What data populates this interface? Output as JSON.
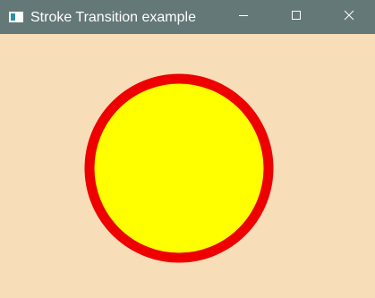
{
  "window": {
    "title": "Stroke Transition example",
    "titlebar_color": "#647878",
    "background_color": "#f7deb8"
  },
  "titlebar_buttons": {
    "minimize_icon": "minimize-icon",
    "maximize_icon": "maximize-icon",
    "close_icon": "close-icon"
  },
  "circle": {
    "fill_color": "#ffff00",
    "stroke_color": "#ee0000"
  }
}
